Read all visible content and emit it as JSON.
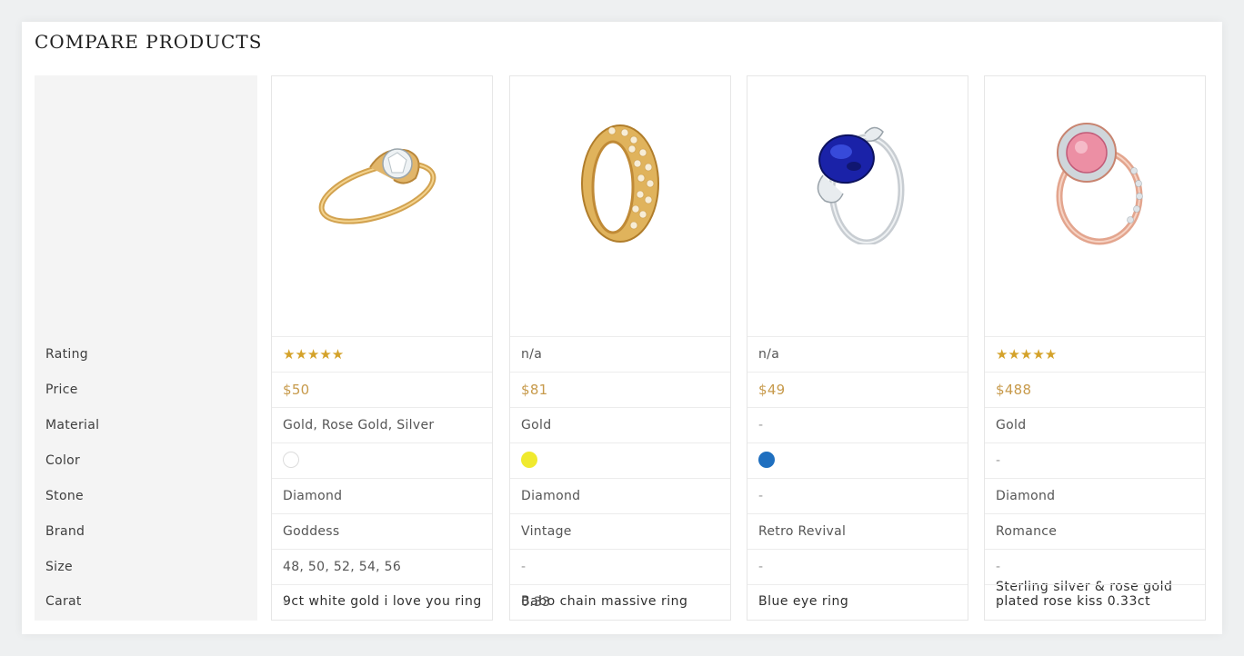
{
  "page": {
    "title": "COMPARE PRODUCTS"
  },
  "labels": {
    "rating": "Rating",
    "price": "Price",
    "material": "Material",
    "color": "Color",
    "stone": "Stone",
    "brand": "Brand",
    "size": "Size",
    "carat": "Carat"
  },
  "products": [
    {
      "name": "9ct white gold i love you ring",
      "rating_value": 4.5,
      "rating_text": "★★★★★",
      "price": "$50",
      "material": "Gold, Rose Gold, Silver",
      "color_hex": "#ffffff",
      "stone": "Diamond",
      "brand": "Goddess",
      "size": "48, 50, 52, 54, 56",
      "carat": "-",
      "image_icon": "gold-ring-icon"
    },
    {
      "name": "Babo chain massive ring",
      "rating_text": "n/a",
      "price": "$81",
      "material": "Gold",
      "color_hex": "#f0ea2e",
      "stone": "Diamond",
      "brand": "Vintage",
      "size": "-",
      "carat": "0.33",
      "image_icon": "pave-band-icon"
    },
    {
      "name": "Blue eye ring",
      "rating_text": "n/a",
      "price": "$49",
      "material": "-",
      "color_hex": "#1f6fbf",
      "stone": "-",
      "brand": "Retro Revival",
      "size": "-",
      "carat": "-",
      "image_icon": "sapphire-ring-icon"
    },
    {
      "name": "Sterling silver & rose gold plated rose kiss 0.33ct",
      "rating_value": 5,
      "rating_text": "★★★★★",
      "price": "$488",
      "material": "Gold",
      "color_hex": "",
      "color_text": "-",
      "stone": "Diamond",
      "brand": "Romance",
      "size": "-",
      "carat": "-",
      "image_icon": "rose-gold-ring-icon"
    }
  ]
}
